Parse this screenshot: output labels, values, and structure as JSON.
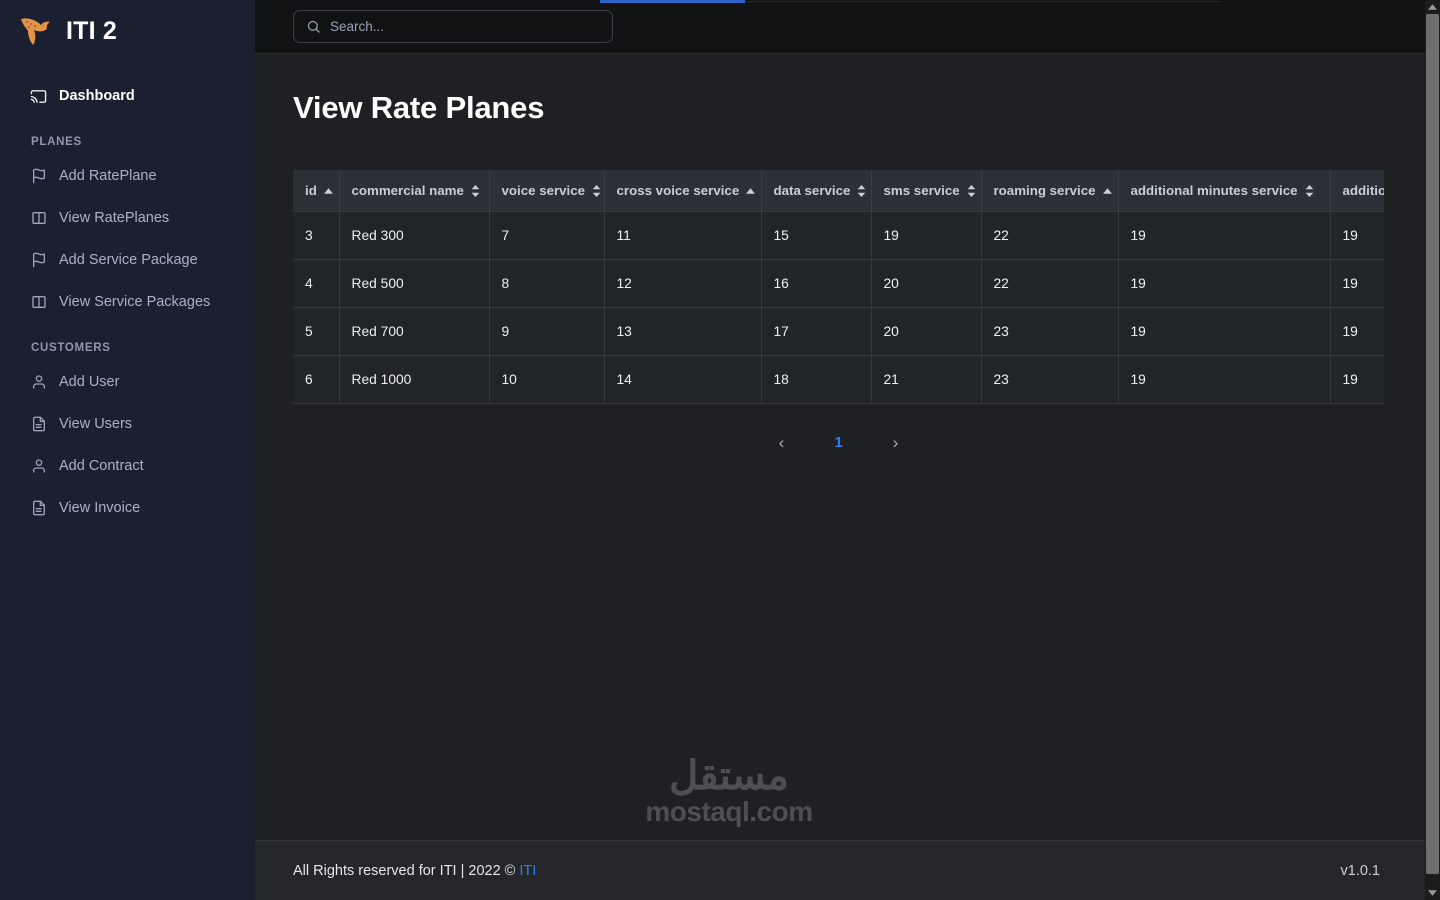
{
  "brand": {
    "title": "ITI 2",
    "logo_icon": "fox-logo-icon",
    "logo_color": "#e59246"
  },
  "sidebar": {
    "primary": [
      {
        "label": "Dashboard",
        "icon": "cast-icon",
        "active": true
      }
    ],
    "groups": [
      {
        "label": "PLANES",
        "items": [
          {
            "label": "Add RatePlane",
            "icon": "flag-icon"
          },
          {
            "label": "View RatePlanes",
            "icon": "columns-icon"
          },
          {
            "label": "Add Service Package",
            "icon": "flag-icon"
          },
          {
            "label": "View Service Packages",
            "icon": "columns-icon"
          }
        ]
      },
      {
        "label": "CUSTOMERS",
        "items": [
          {
            "label": "Add User",
            "icon": "user-icon"
          },
          {
            "label": "View Users",
            "icon": "file-text-icon"
          },
          {
            "label": "Add Contract",
            "icon": "user-icon"
          },
          {
            "label": "View Invoice",
            "icon": "file-text-icon"
          }
        ]
      }
    ]
  },
  "topbar": {
    "search": {
      "placeholder": "Search...",
      "value": "",
      "icon": "search-icon"
    },
    "progress_color": "#2f63c8"
  },
  "main": {
    "page_title": "View Rate Planes"
  },
  "table": {
    "columns": [
      {
        "key": "id",
        "label": "id",
        "sort": "asc",
        "class": "c-id"
      },
      {
        "key": "commercial_name",
        "label": "commercial name",
        "sort": "none",
        "class": "c-name"
      },
      {
        "key": "voice_service",
        "label": "voice service",
        "sort": "none",
        "class": "c-voice"
      },
      {
        "key": "cross_voice_service",
        "label": "cross voice service",
        "sort": "asc",
        "class": "c-cross"
      },
      {
        "key": "data_service",
        "label": "data service",
        "sort": "none",
        "class": "c-data"
      },
      {
        "key": "sms_service",
        "label": "sms service",
        "sort": "none",
        "class": "c-sms"
      },
      {
        "key": "roaming_service",
        "label": "roaming service",
        "sort": "asc",
        "class": "c-roam"
      },
      {
        "key": "additional_minutes_service",
        "label": "additional minutes service",
        "sort": "none",
        "class": "c-addmin"
      },
      {
        "key": "additional_last",
        "label": "additional",
        "sort": "none",
        "class": "c-addlast"
      }
    ],
    "rows": [
      {
        "id": "3",
        "commercial_name": "Red 300",
        "voice_service": "7",
        "cross_voice_service": "11",
        "data_service": "15",
        "sms_service": "19",
        "roaming_service": "22",
        "additional_minutes_service": "19",
        "additional_last": "19"
      },
      {
        "id": "4",
        "commercial_name": "Red 500",
        "voice_service": "8",
        "cross_voice_service": "12",
        "data_service": "16",
        "sms_service": "20",
        "roaming_service": "22",
        "additional_minutes_service": "19",
        "additional_last": "19"
      },
      {
        "id": "5",
        "commercial_name": "Red 700",
        "voice_service": "9",
        "cross_voice_service": "13",
        "data_service": "17",
        "sms_service": "20",
        "roaming_service": "23",
        "additional_minutes_service": "19",
        "additional_last": "19"
      },
      {
        "id": "6",
        "commercial_name": "Red 1000",
        "voice_service": "10",
        "cross_voice_service": "14",
        "data_service": "18",
        "sms_service": "21",
        "roaming_service": "23",
        "additional_minutes_service": "19",
        "additional_last": "19"
      }
    ]
  },
  "pagination": {
    "prev_label": "‹",
    "next_label": "›",
    "pages": [
      "1"
    ],
    "current_page": "1",
    "active_color": "#2f7ef0"
  },
  "watermark": {
    "arabic": "مستقل",
    "latin": "mostaql.com"
  },
  "footer": {
    "copyright_prefix": "All Rights reserved for ITI | 2022 © ",
    "copyright_link": "ITI",
    "version": "v1.0.1"
  }
}
